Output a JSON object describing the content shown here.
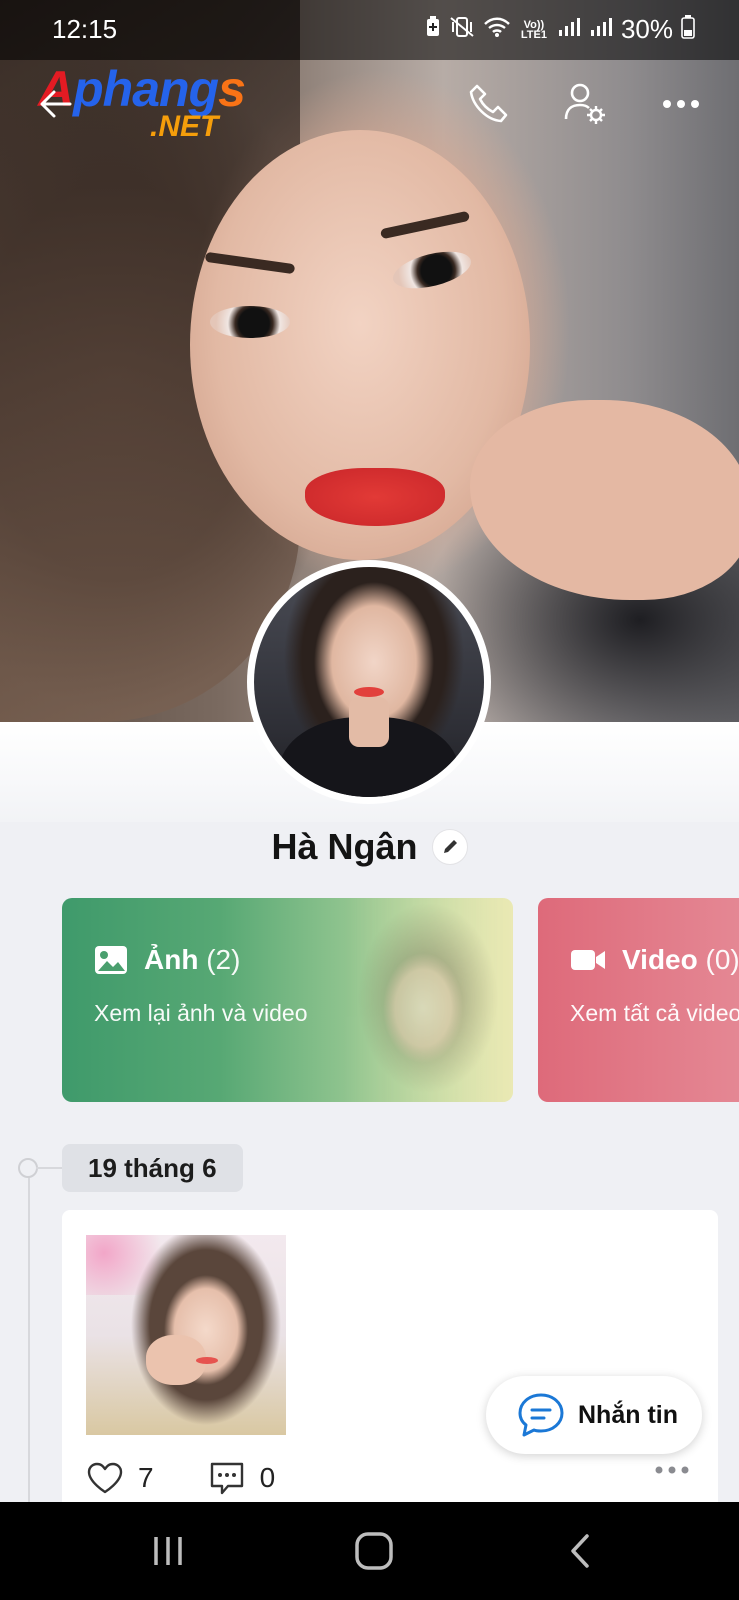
{
  "status_bar": {
    "time": "12:15",
    "network_label": "Vo)) LTE1",
    "battery": "30%",
    "icons": [
      "battery-saver-icon",
      "vibrate-icon",
      "wifi-icon",
      "signal-icon",
      "signal-icon",
      "battery-icon"
    ]
  },
  "watermark": {
    "brand": [
      "A",
      "phang",
      "s"
    ],
    "suffix": ".NET"
  },
  "top_bar": {
    "icons": [
      "back-arrow-icon",
      "phone-icon",
      "profile-settings-icon",
      "more-options-icon"
    ]
  },
  "profile": {
    "name": "Hà Ngân"
  },
  "media_cards": [
    {
      "title": "Ảnh",
      "count": "(2)",
      "subtitle": "Xem lại ảnh và video",
      "icon": "image-icon",
      "color": "#3f9a6b"
    },
    {
      "title": "Video",
      "count": "(0)",
      "subtitle": "Xem tất cả video",
      "icon": "video-icon",
      "color": "#de6a7a"
    }
  ],
  "timeline": {
    "date": "19 tháng 6",
    "post": {
      "likes": "7",
      "comments": "0"
    }
  },
  "fab": {
    "label": "Nhắn tin"
  },
  "nav_bar": {
    "icons": [
      "recent-apps-icon",
      "home-icon",
      "back-icon"
    ]
  }
}
